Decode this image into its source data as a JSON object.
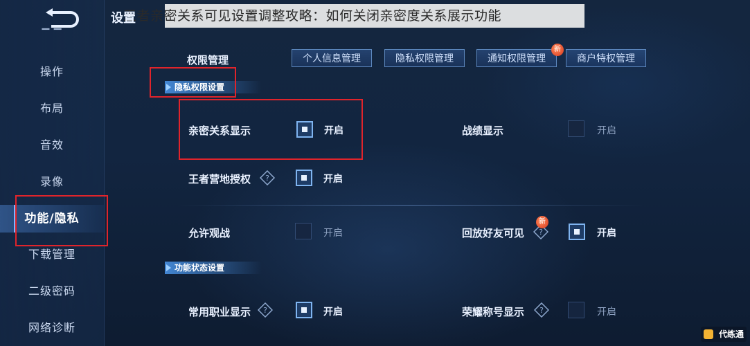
{
  "caption": "王者亲密关系可见设置调整攻略：如何关闭亲密度关系展示功能",
  "header": {
    "title": "设置"
  },
  "sidebar": {
    "items": [
      {
        "label": "操作"
      },
      {
        "label": "布局"
      },
      {
        "label": "音效"
      },
      {
        "label": "录像"
      },
      {
        "label": "功能/隐私",
        "active": true
      },
      {
        "label": "下载管理"
      },
      {
        "label": "二级密码"
      },
      {
        "label": "网络诊断"
      }
    ]
  },
  "permissions": {
    "label": "权限管理",
    "buttons": [
      "个人信息管理",
      "隐私权限管理",
      "通知权限管理",
      "商户特权管理"
    ],
    "new_badge": "新"
  },
  "privacy_section": {
    "title": "隐私权限设置",
    "options": [
      {
        "label": "亲密关系显示",
        "checked": true,
        "state": "开启"
      },
      {
        "label": "战绩显示",
        "checked": false,
        "state": "开启"
      },
      {
        "label": "王者营地授权",
        "checked": true,
        "state": "开启"
      },
      {
        "label": "允许观战",
        "checked": false,
        "state": "开启"
      },
      {
        "label": "回放好友可见",
        "checked": true,
        "state": "开启",
        "badge": "新"
      }
    ]
  },
  "function_section": {
    "title": "功能状态设置",
    "options": [
      {
        "label": "常用职业显示",
        "checked": true,
        "state": "开启"
      },
      {
        "label": "荣耀称号显示",
        "checked": false,
        "state": "开启"
      }
    ]
  },
  "watermark": "代练通",
  "colors": {
    "accent": "#7fb4f0",
    "highlight": "#e0242b",
    "caption_bg": "#eeeeee"
  }
}
